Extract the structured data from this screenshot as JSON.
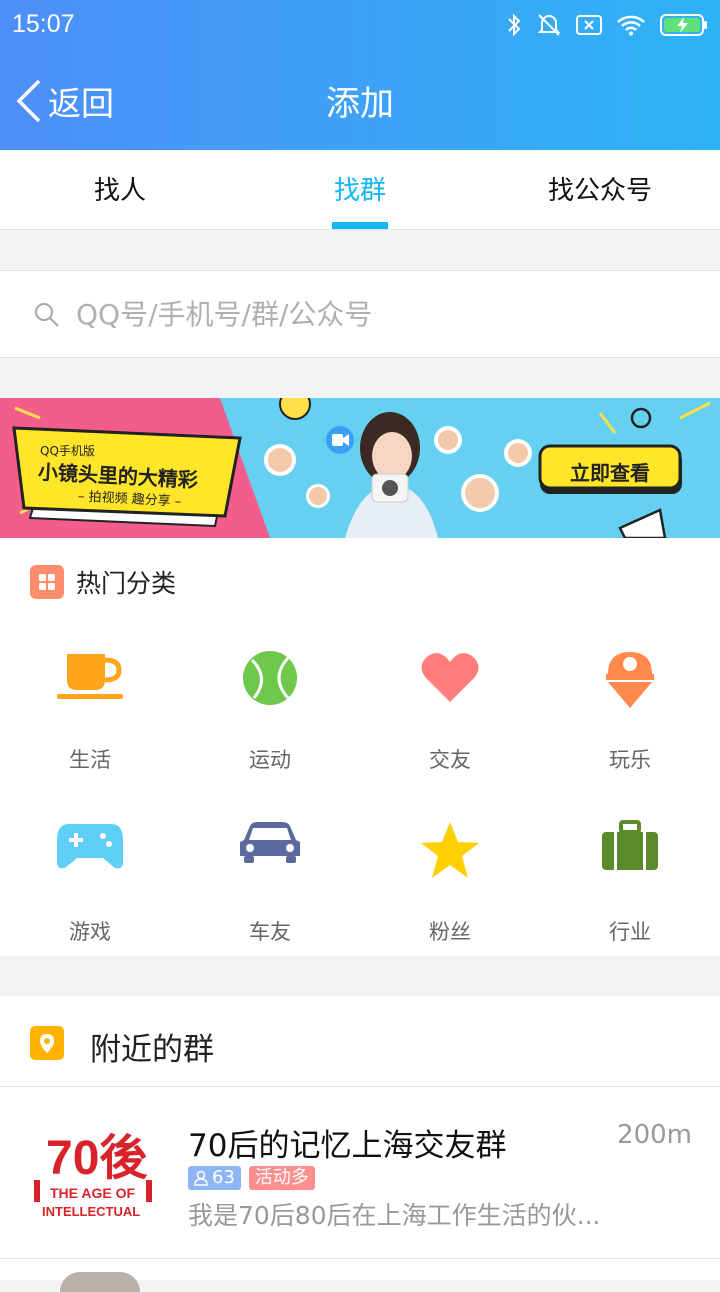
{
  "status_bar": {
    "time": "15:07"
  },
  "nav": {
    "back_label": "返回",
    "title": "添加"
  },
  "tabs": [
    {
      "label": "找人",
      "active": false
    },
    {
      "label": "找群",
      "active": true
    },
    {
      "label": "找公众号",
      "active": false
    }
  ],
  "search": {
    "placeholder": "QQ号/手机号/群/公众号"
  },
  "banner": {
    "small_label": "QQ手机版",
    "headline": "小镜头里的大精彩",
    "subline": "– 拍视频 趣分享 –",
    "cta": "立即查看"
  },
  "hot": {
    "title": "热门分类",
    "items": [
      {
        "label": "生活",
        "icon": "coffee-cup-icon",
        "color": "#ffa41b"
      },
      {
        "label": "运动",
        "icon": "tennis-ball-icon",
        "color": "#6fc74b"
      },
      {
        "label": "交友",
        "icon": "heart-icon",
        "color": "#ff7c7c"
      },
      {
        "label": "玩乐",
        "icon": "ice-cream-icon",
        "color": "#ff8a4c"
      },
      {
        "label": "游戏",
        "icon": "gamepad-icon",
        "color": "#5fcff5"
      },
      {
        "label": "车友",
        "icon": "car-icon",
        "color": "#5a6a9e"
      },
      {
        "label": "粉丝",
        "icon": "star-icon",
        "color": "#ffd000"
      },
      {
        "label": "行业",
        "icon": "briefcase-icon",
        "color": "#5b8a2a"
      }
    ]
  },
  "nearby": {
    "title": "附近的群",
    "groups": [
      {
        "name": "70后的记忆上海交友群",
        "distance": "200m",
        "members": "63",
        "tag": "活动多",
        "desc": "我是70后80后在上海工作生活的伙..."
      }
    ]
  },
  "colors": {
    "accent": "#12b7f5",
    "header_start": "#4d8ff8",
    "header_end": "#2eb4f5"
  }
}
